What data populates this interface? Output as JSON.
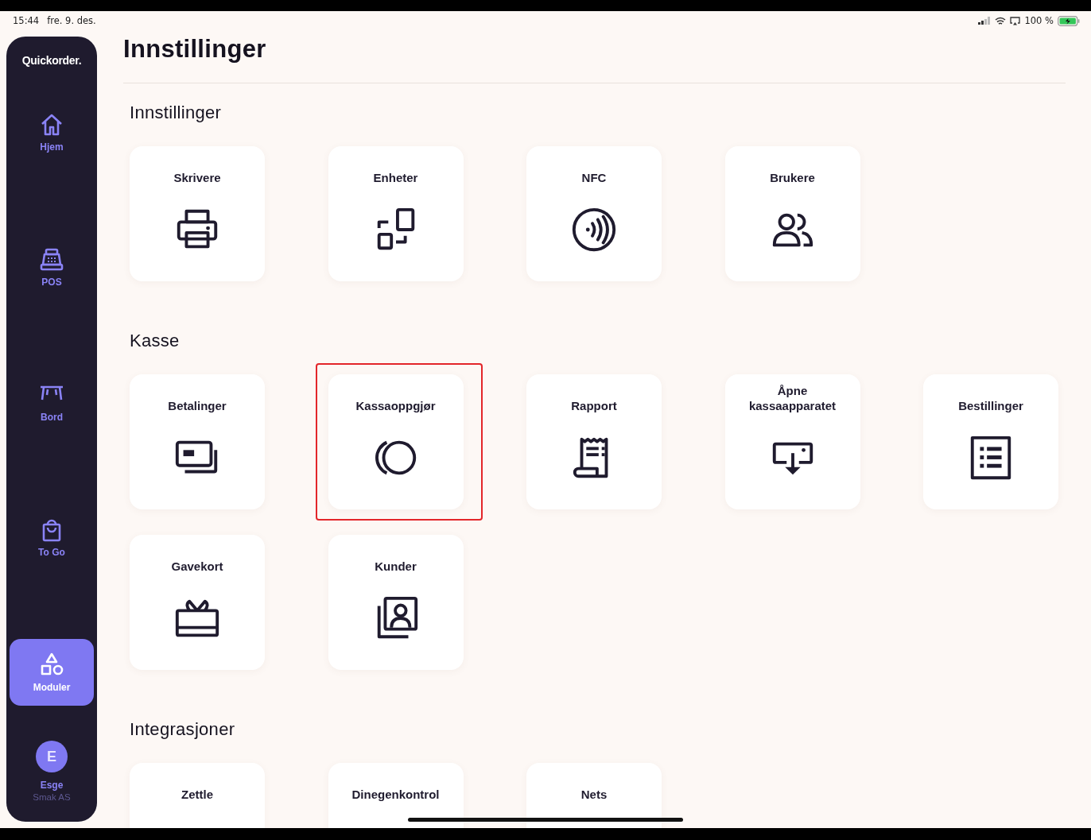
{
  "status_bar": {
    "time": "15:44",
    "date": "fre. 9. des.",
    "battery": "100 %"
  },
  "sidebar": {
    "logo": "Quickorder.",
    "items": [
      {
        "label": "Hjem",
        "selected": false
      },
      {
        "label": "POS",
        "selected": false
      },
      {
        "label": "Bord",
        "selected": false
      },
      {
        "label": "To Go",
        "selected": false
      },
      {
        "label": "Moduler",
        "selected": true
      }
    ],
    "user": {
      "initial": "E",
      "name": "Esge",
      "company": "Smak AS"
    }
  },
  "page": {
    "title": "Innstillinger"
  },
  "sections": [
    {
      "title": "Innstillinger",
      "tiles": [
        {
          "label": "Skrivere",
          "highlighted": false
        },
        {
          "label": "Enheter",
          "highlighted": false
        },
        {
          "label": "NFC",
          "highlighted": false
        },
        {
          "label": "Brukere",
          "highlighted": false
        }
      ]
    },
    {
      "title": "Kasse",
      "tiles": [
        {
          "label": "Betalinger",
          "highlighted": false
        },
        {
          "label": "Kassaoppgjør",
          "highlighted": true
        },
        {
          "label": "Rapport",
          "highlighted": false
        },
        {
          "label": "Åpne kassaapparatet",
          "highlighted": false
        },
        {
          "label": "Bestillinger",
          "highlighted": false
        },
        {
          "label": "Gavekort",
          "highlighted": false
        },
        {
          "label": "Kunder",
          "highlighted": false
        }
      ]
    },
    {
      "title": "Integrasjoner",
      "tiles": [
        {
          "label": "Zettle",
          "highlighted": false
        },
        {
          "label": "Dinegenkontrol",
          "highlighted": false
        },
        {
          "label": "Nets",
          "highlighted": false
        }
      ]
    }
  ]
}
